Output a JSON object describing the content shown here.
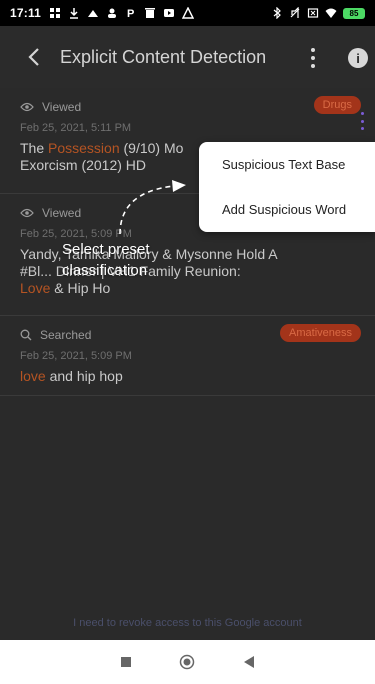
{
  "status_bar": {
    "time": "17:11",
    "battery": "85"
  },
  "app_bar": {
    "title": "Explicit Content Detection"
  },
  "items": [
    {
      "type_label": "Viewed",
      "badge": "Drugs",
      "date": "Feb 25, 2021, 5:11 PM",
      "text_before": "The ",
      "highlight": "Possession",
      "text_after": " (9/10) Mo",
      "text_line2": "Exorcism (2012) HD"
    },
    {
      "type_label": "Viewed",
      "date": "Feb 25, 2021, 5:09 PM",
      "text_line1": "Yandy, Tamika Mallory & Mysonne Hold A",
      "text_line2": "#Bl... Dinner | VH1 Family Reunion:",
      "highlight": "Love",
      "text_after": " & Hip Ho"
    },
    {
      "type_label": "Searched",
      "badge": "Amativeness",
      "date": "Feb 25, 2021, 5:09 PM",
      "highlight": "love",
      "text_after": " and hip hop"
    }
  ],
  "popup": {
    "items": [
      "Suspicious Text Base",
      "Add Suspicious Word"
    ]
  },
  "hint": {
    "line1": "Select preset",
    "line2": "classification"
  },
  "footer": {
    "link": "I need to revoke access to this Google account"
  },
  "colors": {
    "highlight": "#b55423",
    "badge_bg": "#a3341a",
    "kebab": "#7b5cd6",
    "overlay_bg": "#2a2a2a"
  }
}
